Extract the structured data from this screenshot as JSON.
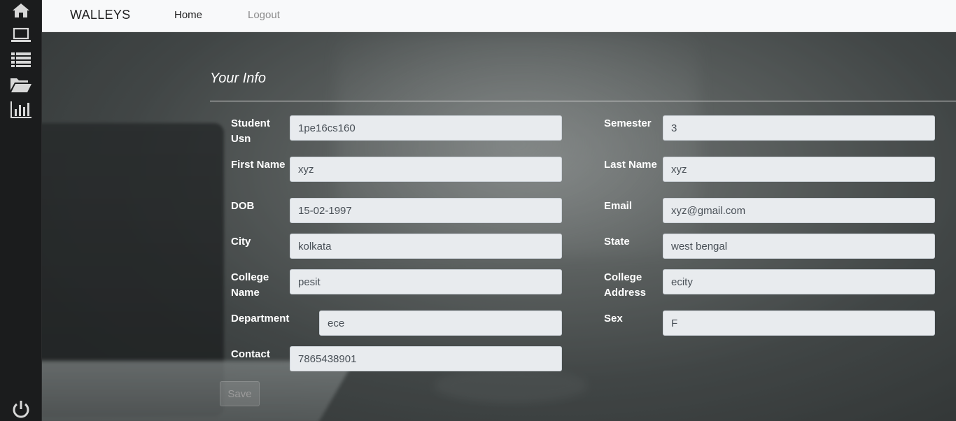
{
  "sidebar": {
    "items": [
      {
        "icon": "home-icon"
      },
      {
        "icon": "laptop-icon"
      },
      {
        "icon": "list-icon"
      },
      {
        "icon": "folder-open-icon"
      },
      {
        "icon": "bar-chart-icon"
      }
    ],
    "bottom_icon": "power-icon"
  },
  "navbar": {
    "brand": "WALLEYS",
    "home": "Home",
    "logout": "Logout"
  },
  "form": {
    "heading": "Your Info",
    "usn_label": "Student Usn",
    "usn_value": "1pe16cs160",
    "semester_label": "Semester",
    "semester_value": "3",
    "first_name_label": "First Name",
    "first_name_value": "xyz",
    "last_name_label": "Last Name",
    "last_name_value": "xyz",
    "dob_label": "DOB",
    "dob_value": "15-02-1997",
    "email_label": "Email",
    "email_value": "xyz@gmail.com",
    "city_label": "City",
    "city_value": "kolkata",
    "state_label": "State",
    "state_value": "west bengal",
    "college_name_label": "College Name",
    "college_name_value": "pesit",
    "college_address_label": "College Address",
    "college_address_value": "ecity",
    "department_label": "Department",
    "department_value": "ece",
    "sex_label": "Sex",
    "sex_value": "F",
    "contact_label": "Contact",
    "contact_value": "7865438901",
    "save_label": "Save"
  }
}
